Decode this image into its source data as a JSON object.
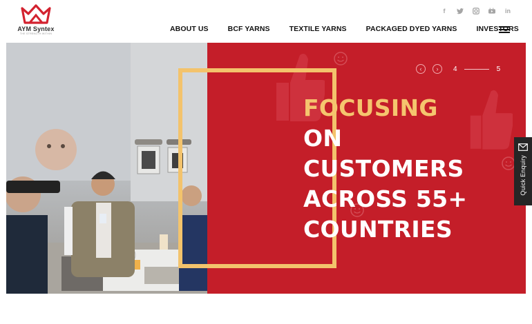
{
  "brand": {
    "name": "AYM Syntex",
    "tagline": "THE STRENGTH WITHIN",
    "accent_color": "#d3222f"
  },
  "social": [
    {
      "name": "facebook-icon",
      "glyph": "f"
    },
    {
      "name": "twitter-icon",
      "glyph": "t"
    },
    {
      "name": "instagram-icon",
      "glyph": "◻"
    },
    {
      "name": "youtube-icon",
      "glyph": "▶"
    },
    {
      "name": "linkedin-icon",
      "glyph": "in"
    }
  ],
  "nav": {
    "items": [
      "ABOUT US",
      "BCF YARNS",
      "TEXTILE YARNS",
      "PACKAGED DYED YARNS",
      "INVESTORS"
    ]
  },
  "hero": {
    "line1": "FOCUSING",
    "line2": "ON",
    "line3": "CUSTOMERS",
    "line4": "ACROSS 55+",
    "line5": "COUNTRIES",
    "headline_accent": "#f5c56e",
    "panel_color": "#c41e29",
    "frame_color": "#f3c36c",
    "slide_current": "4",
    "slide_total": "5"
  },
  "quick_enquiry": {
    "label": "Quick Enquiry"
  }
}
